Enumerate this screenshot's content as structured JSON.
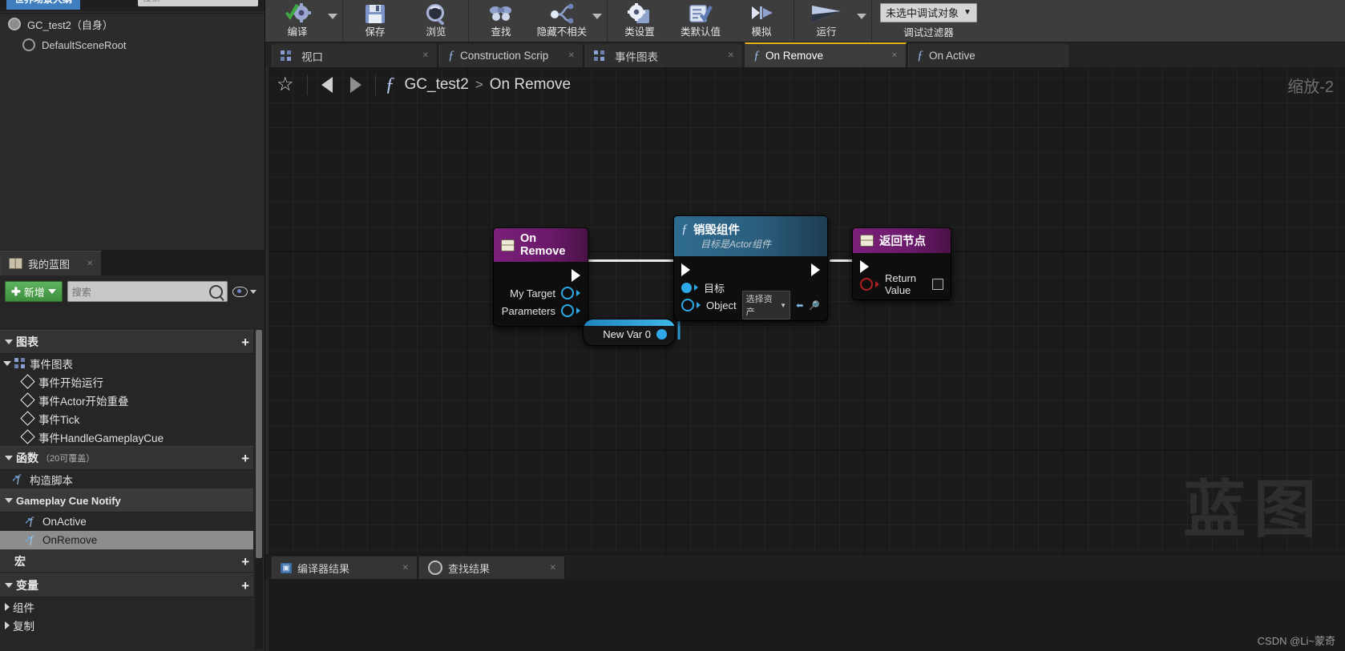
{
  "outliner": {
    "tab_label": "世界场景大纲",
    "search_placeholder": "搜索",
    "rows": [
      {
        "label": "GC_test2（自身）",
        "indent": false
      },
      {
        "label": "DefaultSceneRoot",
        "indent": true
      }
    ]
  },
  "myblueprint": {
    "tab_label": "我的蓝图",
    "add_label": "新增",
    "search_placeholder": "搜索",
    "sections": [
      {
        "title": "图表",
        "count": "",
        "plus": "+"
      },
      {
        "title": "函数",
        "count": "（20可覆盖）",
        "plus": "+"
      },
      {
        "title": "宏",
        "count": "",
        "plus": "+"
      },
      {
        "title": "变量",
        "count": "",
        "plus": "+"
      }
    ],
    "graph_root": "事件图表",
    "events": [
      "事件开始运行",
      "事件Actor开始重叠",
      "事件Tick",
      "事件HandleGameplayCue"
    ],
    "functions_items": [
      "构造脚本"
    ],
    "function_group": "Gameplay Cue Notify",
    "function_group_items": [
      "OnActive",
      "OnRemove"
    ],
    "selected_function": "OnRemove",
    "variables_items": [
      "组件",
      "复制"
    ]
  },
  "toolbar": {
    "groups": [
      {
        "items": [
          {
            "label": "编译",
            "icon": "compile-icon",
            "dropdown": true
          }
        ]
      },
      {
        "items": [
          {
            "label": "保存",
            "icon": "save-icon",
            "dropdown": false
          },
          {
            "label": "浏览",
            "icon": "browse-icon",
            "dropdown": false
          }
        ]
      },
      {
        "items": [
          {
            "label": "查找",
            "icon": "find-icon",
            "dropdown": false
          },
          {
            "label": "隐藏不相关",
            "icon": "hide-unrelated-icon",
            "dropdown": true
          }
        ]
      },
      {
        "items": [
          {
            "label": "类设置",
            "icon": "class-settings-icon",
            "dropdown": false
          },
          {
            "label": "类默认值",
            "icon": "class-defaults-icon",
            "dropdown": false
          },
          {
            "label": "模拟",
            "icon": "simulate-icon",
            "dropdown": false
          }
        ]
      },
      {
        "items": [
          {
            "label": "运行",
            "icon": "play-icon",
            "dropdown": true
          }
        ]
      }
    ],
    "debug_object": "未选中调试对象",
    "debug_filter_label": "调试过滤器"
  },
  "graph_tabs": [
    {
      "label": "视口",
      "icon": "viewport-icon",
      "active": false
    },
    {
      "label": "Construction Scrip",
      "icon": "function-icon",
      "active": false
    },
    {
      "label": "事件图表",
      "icon": "graph-icon",
      "active": false
    },
    {
      "label": "On Remove",
      "icon": "function-icon",
      "active": true
    },
    {
      "label": "On Active",
      "icon": "function-icon",
      "active": false
    }
  ],
  "breadcrumb": {
    "blueprint": "GC_test2",
    "separator": ">",
    "graph": "On Remove",
    "zoom": "缩放-2"
  },
  "graph": {
    "watermark": "蓝图",
    "nodes": [
      {
        "id": "on-remove",
        "type": "event",
        "title": "On Remove",
        "subtitle": "",
        "outputs": [
          {
            "label": "",
            "pin": "exec"
          },
          {
            "label": "My Target",
            "pin": "object"
          },
          {
            "label": "Parameters",
            "pin": "object"
          }
        ]
      },
      {
        "id": "destroy-component",
        "type": "function",
        "title": "销毁组件",
        "subtitle": "目标是Actor组件",
        "inputs": [
          {
            "label": "",
            "pin": "exec"
          },
          {
            "label": "目标",
            "pin": "object-filled"
          },
          {
            "label": "Object",
            "pin": "object",
            "dropdown": "选择资产"
          }
        ]
      },
      {
        "id": "return-node",
        "type": "event",
        "title": "返回节点",
        "subtitle": "",
        "inputs": [
          {
            "label": "",
            "pin": "exec"
          },
          {
            "label": "Return Value",
            "pin": "bool",
            "checkbox": true
          }
        ]
      },
      {
        "id": "new-var-0",
        "type": "variable",
        "title": "New Var 0"
      }
    ]
  },
  "bottom_panel": {
    "tabs": [
      {
        "label": "编译器结果",
        "icon": "compiler-results-icon"
      },
      {
        "label": "查找结果",
        "icon": "find-results-icon"
      }
    ]
  },
  "credit": "CSDN @Li~蒙奇"
}
